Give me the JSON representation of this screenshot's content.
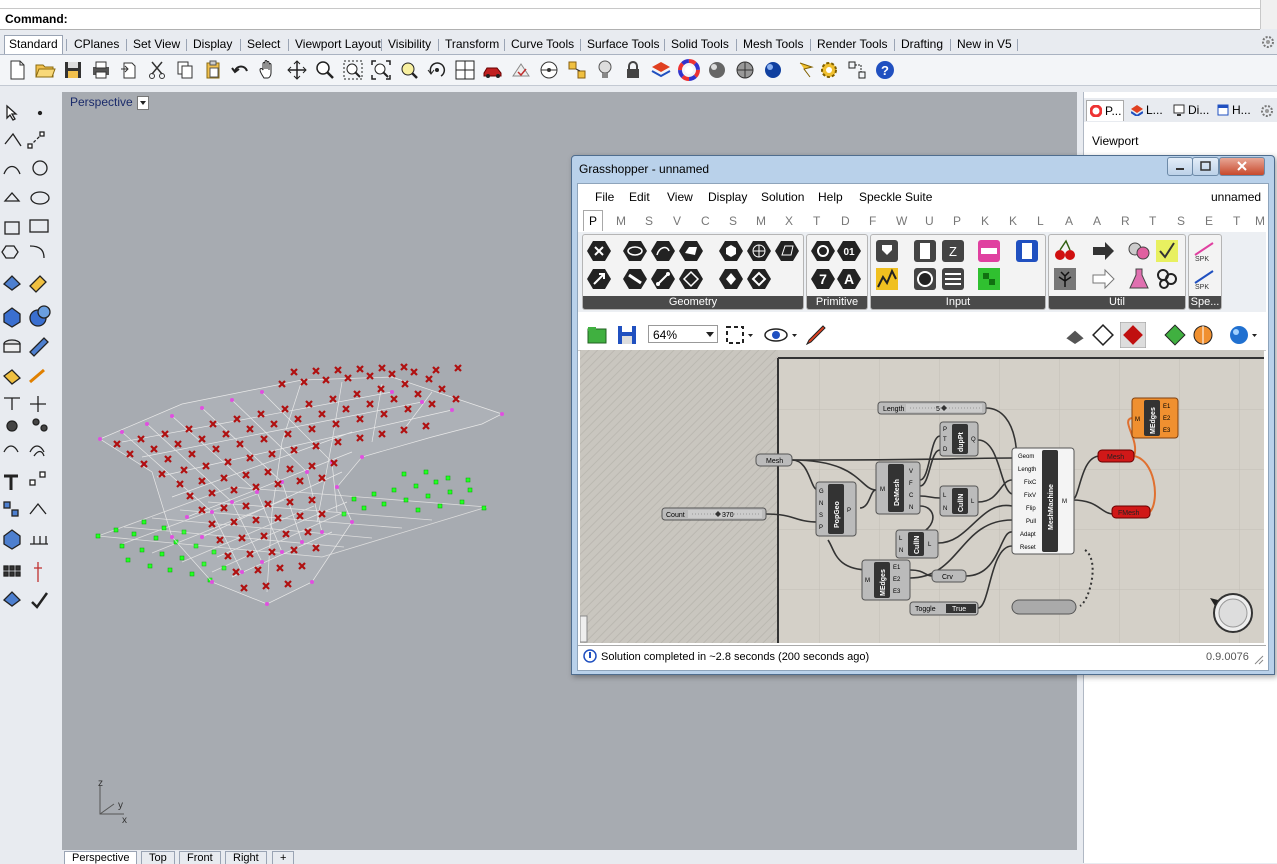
{
  "command": {
    "label": "Command:"
  },
  "toolbar_tabs": [
    "Standard",
    "CPlanes",
    "Set View",
    "Display",
    "Select",
    "Viewport Layout",
    "Visibility",
    "Transform",
    "Curve Tools",
    "Surface Tools",
    "Solid Tools",
    "Mesh Tools",
    "Render Tools",
    "Drafting",
    "New in V5"
  ],
  "toolbar_icons": [
    "new-icon",
    "open-icon",
    "save-icon",
    "print-icon",
    "import-icon",
    "cut-icon",
    "copy-icon",
    "paste-icon",
    "undo-icon",
    "pan-icon",
    "rotate-view-icon",
    "zoom-icon",
    "zoom-window-icon",
    "zoom-extents-icon",
    "zoom-selected-icon",
    "rotate-icon",
    "viewport-layout-icon",
    "car-icon",
    "grid-snap-icon",
    "construction-plane-icon",
    "osnap-icon",
    "light-icon",
    "lock-icon",
    "layer-icon",
    "color-wheel-icon",
    "shade-icon",
    "render-preview-icon",
    "render-sphere-icon",
    "sun-icon",
    "gear-icon",
    "options-icon",
    "help-icon"
  ],
  "viewport": {
    "title": "Perspective",
    "tabs": [
      "Perspective",
      "Top",
      "Front",
      "Right"
    ],
    "axes": {
      "z": "z",
      "y": "y",
      "x": "x"
    }
  },
  "right_panel": {
    "tabs": [
      "P...",
      "L...",
      "Di...",
      "H..."
    ],
    "title": "Viewport"
  },
  "grasshopper": {
    "title": "Grasshopper - unnamed",
    "menu": [
      "File",
      "Edit",
      "View",
      "Display",
      "Solution",
      "Help",
      "Speckle Suite"
    ],
    "doc_name": "unnamed",
    "category_tabs": [
      "P",
      "M",
      "S",
      "V",
      "C",
      "S",
      "M",
      "X",
      "T",
      "D",
      "F",
      "W",
      "U",
      "P",
      "K",
      "K",
      "L",
      "A",
      "A",
      "R",
      "T",
      "S",
      "E",
      "T",
      "M"
    ],
    "ribbon_groups": [
      "Geometry",
      "Primitive",
      "Input",
      "Util",
      "Spe..."
    ],
    "zoom": "64%",
    "status": "Solution completed in ~2.8 seconds (200 seconds ago)",
    "version": "0.9.0076",
    "components": {
      "length_slider": {
        "label": "Length",
        "value": "5"
      },
      "count_slider": {
        "label": "Count",
        "value": "370"
      },
      "mesh_param": "Mesh",
      "popgeo": {
        "name": "PopGeo",
        "inputs": [
          "G",
          "N",
          "S",
          "P"
        ],
        "output": "P"
      },
      "demesh": {
        "name": "DeMesh",
        "input": "M",
        "outputs": [
          "V",
          "F",
          "C",
          "N"
        ]
      },
      "duppt": {
        "name": "dupPt",
        "inputs": [
          "P",
          "T",
          "D"
        ],
        "output": "Q"
      },
      "cullN_top": {
        "name": "CullN",
        "inputs": [
          "L",
          "N"
        ],
        "output": "L"
      },
      "cullN_bottom": {
        "name": "CullN",
        "inputs": [
          "L",
          "N"
        ],
        "output": "L"
      },
      "medges_bottom": {
        "name": "MEdges",
        "input": "M",
        "outputs": [
          "E1",
          "E2",
          "E3"
        ]
      },
      "crv_param": "Crv",
      "toggle": {
        "label": "Toggle",
        "value": "True"
      },
      "meshmachine": {
        "name": "MeshMachine",
        "inputs": [
          "Geom",
          "Length",
          "FixC",
          "FixV",
          "Flip",
          "Pull",
          "Adapt",
          "Reset"
        ],
        "output": "M"
      },
      "mesh_out": "Mesh",
      "fmesh_out": "FMesh",
      "medges_top": {
        "name": "MEdges",
        "input": "M",
        "outputs": [
          "E1",
          "E2",
          "E3"
        ]
      }
    }
  }
}
